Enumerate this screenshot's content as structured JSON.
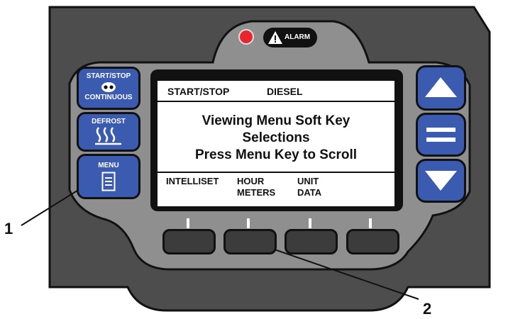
{
  "alarm": {
    "label": "ALARM"
  },
  "buttons": {
    "start_stop": {
      "top": "START/STOP",
      "bottom": "CONTINUOUS"
    },
    "defrost": {
      "label": "DEFROST"
    },
    "menu": {
      "label": "MENU"
    }
  },
  "display": {
    "status_mode": "START/STOP",
    "status_fuel": "DIESEL",
    "message_line1": "Viewing Menu Soft Key",
    "message_line2": "Selections",
    "message_line3": "Press Menu Key to Scroll",
    "softkeys": [
      {
        "line1": "INTELLISET",
        "line2": ""
      },
      {
        "line1": "HOUR",
        "line2": "METERS"
      },
      {
        "line1": "UNIT",
        "line2": "DATA"
      }
    ]
  },
  "callouts": {
    "one": "1",
    "two": "2"
  },
  "colors": {
    "button_blue": "#3a5bb0",
    "bezel": "#4a4a4a",
    "panel": "#8f8f8f",
    "alarm_led": "#e8242c"
  }
}
